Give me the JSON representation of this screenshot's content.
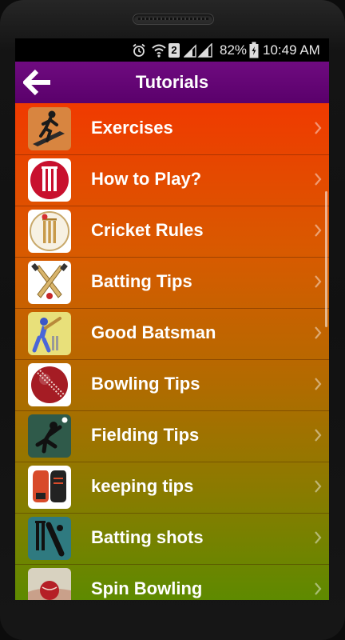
{
  "status_bar": {
    "battery": "82%",
    "time": "10:49 AM",
    "sim_badge": "2"
  },
  "app_bar": {
    "title": "Tutorials"
  },
  "items": [
    {
      "label": "Exercises",
      "icon": "exercise-runner-icon"
    },
    {
      "label": "How to Play?",
      "icon": "cricket-stumps-icon"
    },
    {
      "label": "Cricket Rules",
      "icon": "wickets-ball-icon"
    },
    {
      "label": "Batting Tips",
      "icon": "crossed-bats-icon"
    },
    {
      "label": "Good Batsman",
      "icon": "batsman-icon"
    },
    {
      "label": "Bowling Tips",
      "icon": "cricket-ball-icon"
    },
    {
      "label": "Fielding Tips",
      "icon": "fielder-icon"
    },
    {
      "label": "keeping tips",
      "icon": "keeping-gloves-icon"
    },
    {
      "label": "Batting shots",
      "icon": "batting-shot-icon"
    },
    {
      "label": "Spin Bowling",
      "icon": "spin-ball-icon"
    }
  ],
  "colors": {
    "app_bar": "#6f0b80",
    "list_top": "#f03a00",
    "list_bottom": "#5e8a00"
  }
}
